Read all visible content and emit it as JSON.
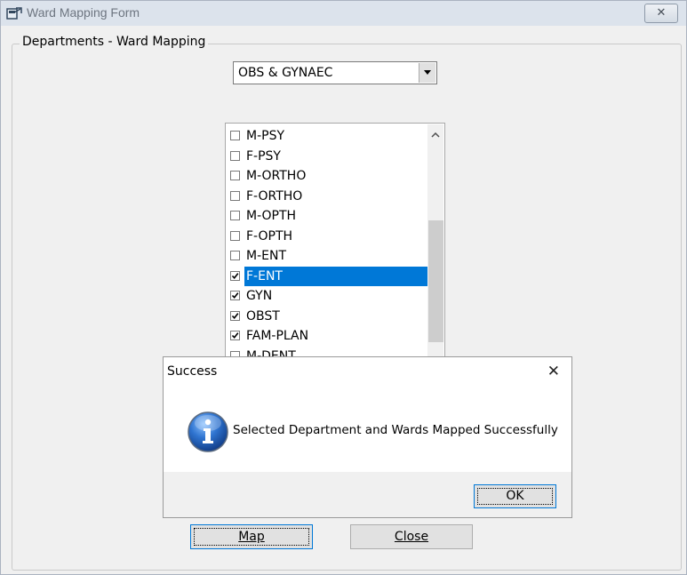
{
  "window": {
    "title": "Ward  Mapping Form",
    "close_glyph": "✕"
  },
  "group": {
    "label": "Departments - Ward Mapping"
  },
  "department_select": {
    "value": "OBS & GYNAEC"
  },
  "wards": [
    {
      "label": "M-PSY",
      "checked": false,
      "selected": false
    },
    {
      "label": "F-PSY",
      "checked": false,
      "selected": false
    },
    {
      "label": "M-ORTHO",
      "checked": false,
      "selected": false
    },
    {
      "label": "F-ORTHO",
      "checked": false,
      "selected": false
    },
    {
      "label": "M-OPTH",
      "checked": false,
      "selected": false
    },
    {
      "label": "F-OPTH",
      "checked": false,
      "selected": false
    },
    {
      "label": "M-ENT",
      "checked": false,
      "selected": false
    },
    {
      "label": "F-ENT",
      "checked": true,
      "selected": true
    },
    {
      "label": "GYN",
      "checked": true,
      "selected": false
    },
    {
      "label": "OBST",
      "checked": true,
      "selected": false
    },
    {
      "label": "FAM-PLAN",
      "checked": true,
      "selected": false
    },
    {
      "label": "M-DENT",
      "checked": false,
      "selected": false
    }
  ],
  "buttons": {
    "map_label": "Map",
    "close_label": "Close"
  },
  "dialog": {
    "title": "Success",
    "message": "Selected Department and Wards Mapped Successfully",
    "ok_label": "OK",
    "close_glyph": "✕",
    "icon": "information-icon"
  },
  "colors": {
    "selection": "#0078d7",
    "window_bg": "#f0f0f0"
  }
}
